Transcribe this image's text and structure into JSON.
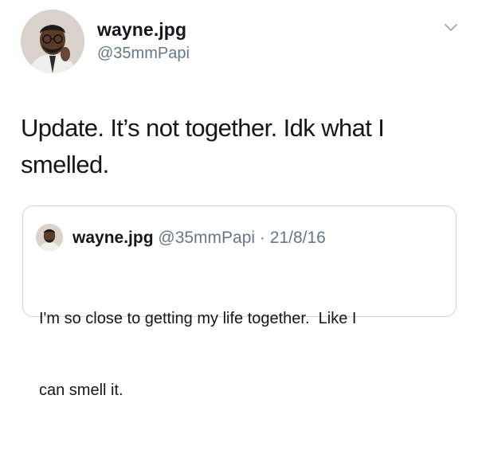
{
  "tweet": {
    "display_name": "wayne.jpg",
    "handle": "@35mmPapi",
    "text_line1": "Update. It’s not together. Idk what I",
    "text_line2": "smelled.",
    "menu_icon": "chevron-down-icon"
  },
  "quoted_tweet": {
    "display_name": "wayne.jpg",
    "handle": "@35mmPapi",
    "separator": "·",
    "date": "21/8/16",
    "text_line1": "I'm so close to getting my life together.  Like I",
    "text_line2": "can smell it."
  },
  "colors": {
    "text": "#14171a",
    "secondary": "#657786",
    "border": "#ccd6dd",
    "background": "#ffffff"
  }
}
